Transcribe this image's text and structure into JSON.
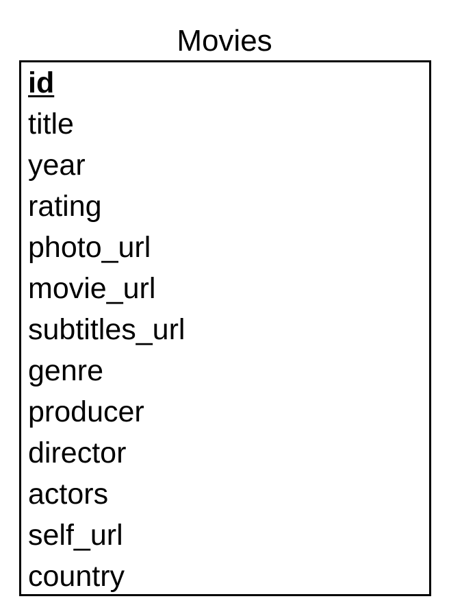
{
  "entity": {
    "name": "Movies",
    "primary_key": "id",
    "attributes": [
      "title",
      "year",
      "rating",
      "photo_url",
      "movie_url",
      "subtitles_url",
      "genre",
      "producer",
      "director",
      "actors",
      "self_url",
      "country"
    ]
  }
}
